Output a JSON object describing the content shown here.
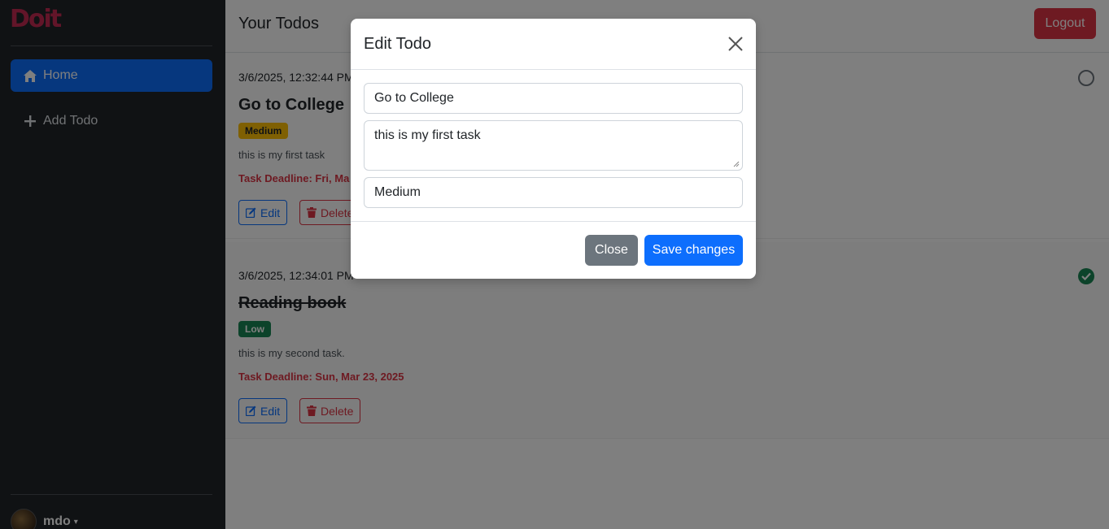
{
  "app": {
    "logo_text": "Doit"
  },
  "sidebar": {
    "items": [
      {
        "label": "Home",
        "icon": "home-icon",
        "active": true
      },
      {
        "label": "Add Todo",
        "icon": "plus-icon",
        "active": false
      }
    ],
    "user": {
      "name": "mdo"
    }
  },
  "header": {
    "title": "Your Todos",
    "logout_label": "Logout"
  },
  "todos": [
    {
      "date": "3/6/2025, 12:32:44 PM",
      "title": "Go to College",
      "priority": "Medium",
      "description": "this is my first task",
      "deadline": "Task Deadline: Fri, Ma",
      "completed": false,
      "edit_label": "Edit",
      "delete_label": "Delete"
    },
    {
      "date": "3/6/2025, 12:34:01 PM",
      "title": "Reading book",
      "priority": "Low",
      "description": "this is my second task.",
      "deadline": "Task Deadline: Sun, Mar 23, 2025",
      "completed": true,
      "edit_label": "Edit",
      "delete_label": "Delete"
    }
  ],
  "modal": {
    "title": "Edit Todo",
    "fields": {
      "title_value": "Go to College",
      "description_value": "this is my first task",
      "priority_value": "Medium"
    },
    "close_label": "Close",
    "save_label": "Save changes"
  },
  "colors": {
    "primary": "#0d6efd",
    "danger": "#dc3545",
    "success": "#198754",
    "warning": "#ffc107",
    "secondary": "#6c757d",
    "sidebar_bg": "#212529",
    "logo": "#c42b52"
  }
}
